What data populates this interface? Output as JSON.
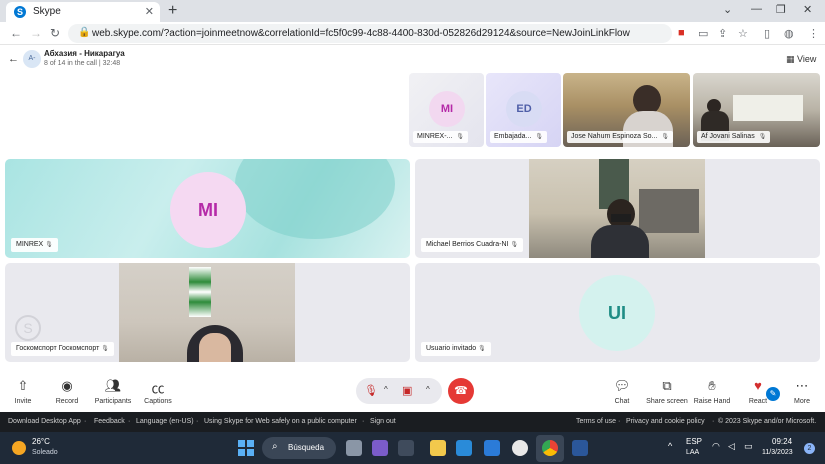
{
  "browser": {
    "tab_title": "Skype",
    "url": "web.skype.com/?action=joinmeetnow&correlationId=fc5f0c99-4c88-4400-830d-052826d29124&source=NewJoinLinkFlow"
  },
  "header": {
    "avatar_initials": "A-",
    "title": "Абхазия - Никарагуа",
    "subtitle": "8 of 14 in the call | 32:48",
    "view_label": "View"
  },
  "thumbnails": [
    {
      "initials": "MI",
      "label": "MINREX-..."
    },
    {
      "initials": "ED",
      "label": "Embajada..."
    },
    {
      "label": "Jose Nahum Espinoza So..."
    },
    {
      "label": "Af Jovani Salinas"
    }
  ],
  "tiles": {
    "minrex": {
      "initials": "MI",
      "label": "MINREX"
    },
    "michael": {
      "label": "Michael Berrios Cuadra-NI"
    },
    "gosk": {
      "label": "Госкомспорт Госкомспорт"
    },
    "usuario": {
      "initials": "UI",
      "label": "Usuario invitado"
    }
  },
  "toolbar": {
    "invite": "Invite",
    "record": "Record",
    "participants": "Participants",
    "captions": "Captions",
    "chat": "Chat",
    "share": "Share screen",
    "raise": "Raise Hand",
    "react": "React",
    "more": "More"
  },
  "footer": {
    "download": "Download Desktop App",
    "feedback": "Feedback",
    "language": "Language (en-US)",
    "safely": "Using Skype for Web safely on a public computer",
    "signout": "Sign out",
    "terms": "Terms of use",
    "privacy": "Privacy and cookie policy",
    "copyright": "© 2023 Skype and/or Microsoft."
  },
  "taskbar": {
    "temp": "26°C",
    "weather": "Soleado",
    "search": "Búsqueda",
    "lang1": "ESP",
    "lang2": "LAA",
    "time": "09:24",
    "date": "11/3/2023",
    "badge": "2"
  },
  "colors": {
    "accent": "#0078d4",
    "end_call": "#e53935",
    "mi_text": "#b52aa8",
    "teal_tile": "#a9e4e2"
  }
}
